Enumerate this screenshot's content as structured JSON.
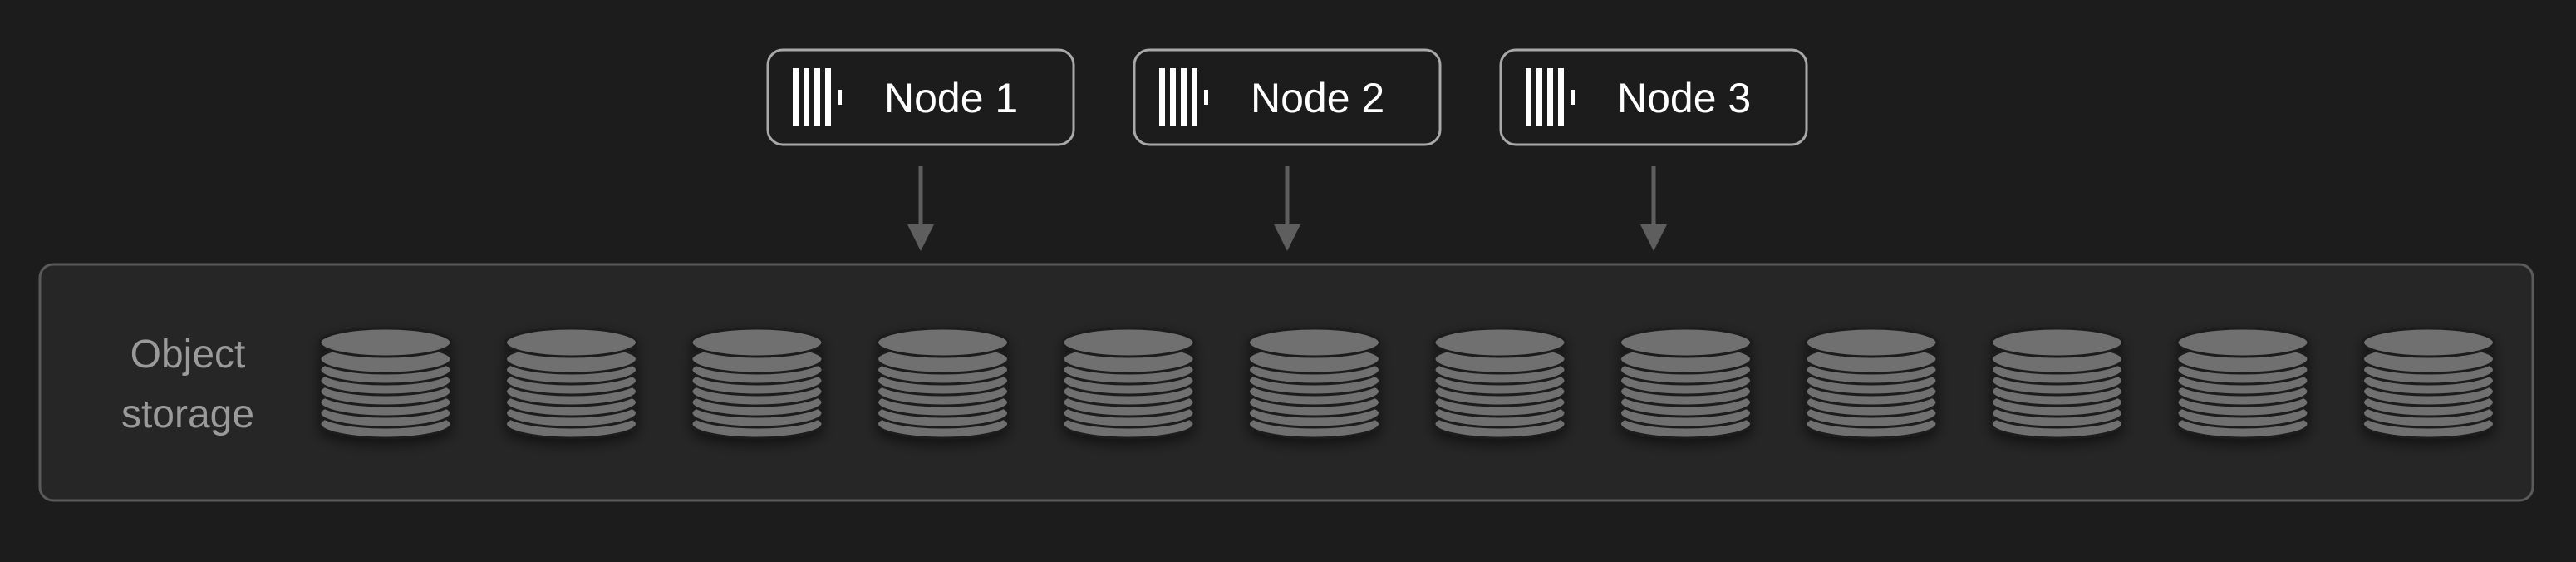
{
  "diagram": {
    "nodes": [
      {
        "label": "Node 1"
      },
      {
        "label": "Node 2"
      },
      {
        "label": "Node 3"
      }
    ],
    "storage": {
      "label_line1": "Object",
      "label_line2": "storage",
      "cylinder_count": 12
    },
    "colors": {
      "background": "#1c1c1c",
      "panel": "#262626",
      "panel_border": "#5a5a5a",
      "node_border": "#a9a9a9",
      "cylinder": "#707070",
      "arrow": "#5e5e5e",
      "text": "#ffffff",
      "muted_text": "#9a9a9a"
    },
    "icons": {
      "node": "server-bars-icon",
      "storage": "disk-stack-icon"
    }
  }
}
